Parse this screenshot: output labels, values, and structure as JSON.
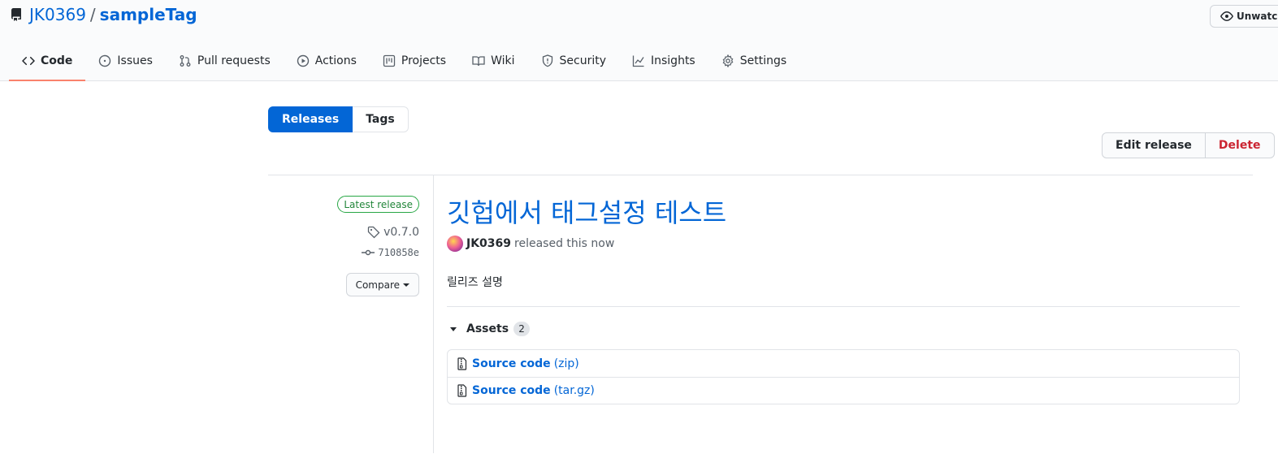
{
  "repo": {
    "owner": "JK0369",
    "separator": "/",
    "name": "sampleTag"
  },
  "watch": {
    "label": "Unwatch"
  },
  "tabs": [
    {
      "label": "Code",
      "icon": "code-icon",
      "active": true
    },
    {
      "label": "Issues",
      "icon": "issue-icon"
    },
    {
      "label": "Pull requests",
      "icon": "pull-request-icon"
    },
    {
      "label": "Actions",
      "icon": "play-icon"
    },
    {
      "label": "Projects",
      "icon": "project-icon"
    },
    {
      "label": "Wiki",
      "icon": "book-icon"
    },
    {
      "label": "Security",
      "icon": "shield-icon"
    },
    {
      "label": "Insights",
      "icon": "graph-icon"
    },
    {
      "label": "Settings",
      "icon": "gear-icon"
    }
  ],
  "subnav": {
    "releases": "Releases",
    "tags": "Tags"
  },
  "actions": {
    "edit": "Edit release",
    "delete": "Delete"
  },
  "release": {
    "latest_label": "Latest release",
    "tag": "v0.7.0",
    "commit": "710858e",
    "compare": "Compare",
    "title": "깃헙에서 태그설정 테스트",
    "author": "JK0369",
    "released_text": "released this now",
    "description": "릴리즈 설명"
  },
  "assets": {
    "label": "Assets",
    "count": "2",
    "items": [
      {
        "name": "Source code",
        "ext": "(zip)"
      },
      {
        "name": "Source code",
        "ext": "(tar.gz)"
      }
    ]
  },
  "colors": {
    "link": "#0366d6",
    "active_tab": "#f9826c",
    "danger": "#cb2431",
    "success": "#28a745"
  }
}
